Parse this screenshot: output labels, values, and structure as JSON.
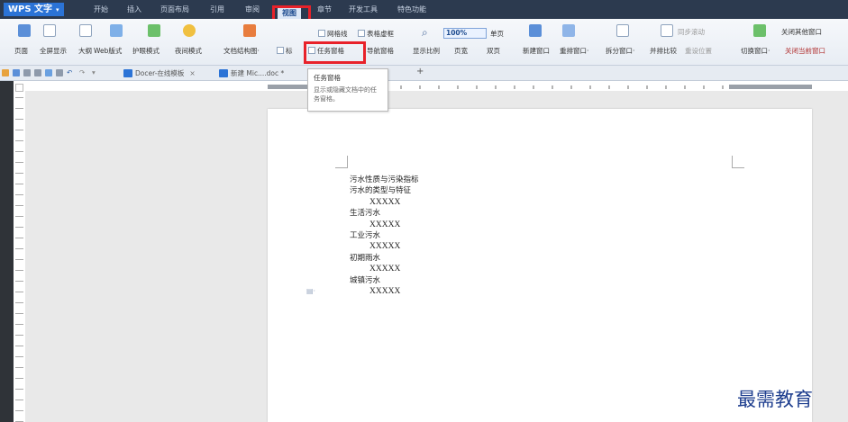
{
  "app": {
    "name": "WPS 文字"
  },
  "menu": {
    "tabs": [
      "开始",
      "插入",
      "页面布局",
      "引用",
      "审阅",
      "视图",
      "章节",
      "开发工具",
      "特色功能"
    ],
    "active": "视图"
  },
  "ribbon": {
    "left_buttons": [
      "页面",
      "全屏显示",
      "大纲",
      "Web版式",
      "护眼模式",
      "夜间模式"
    ],
    "doc_structure": "文档结构图·",
    "checkbox_fragment": "标",
    "gridlines": "网格线",
    "table_grid": "表格虚框",
    "task_pane": "任务窗格",
    "nav_pane": "导航窗格",
    "zoom_label": "显示比例",
    "zoom_value": "100%",
    "single_page": "单页",
    "page_width": "页宽",
    "two_pages": "双页",
    "new_window": "新建窗口",
    "arrange_window": "重排窗口·",
    "split_window": "拆分窗口·",
    "side_by_side": "并排比较",
    "sync_scroll": "同步滚动",
    "reset_position": "重设位置",
    "switch_window": "切换窗口·",
    "close_other": "关闭其他窗口",
    "close_current": "关闭当前窗口"
  },
  "tabbar": {
    "tabs": [
      "Docer-在线模板",
      "新建 Mic....doc *"
    ],
    "add": "+"
  },
  "tooltip": {
    "title": "任务窗格",
    "description": "显示或隐藏文档中的任务窗格。"
  },
  "document": {
    "lines": [
      {
        "text": "污水性质与污染指标",
        "kind": "heading"
      },
      {
        "text": "污水的类型与特征",
        "kind": "heading"
      },
      {
        "text": "XXXXX",
        "kind": "body"
      },
      {
        "text": "生活污水",
        "kind": "heading"
      },
      {
        "text": "XXXXX",
        "kind": "body"
      },
      {
        "text": "工业污水",
        "kind": "heading"
      },
      {
        "text": "XXXXX",
        "kind": "body"
      },
      {
        "text": "初期雨水",
        "kind": "heading"
      },
      {
        "text": "XXXXX",
        "kind": "body"
      },
      {
        "text": "城镇污水",
        "kind": "heading"
      },
      {
        "text": "XXXXX",
        "kind": "body"
      }
    ]
  },
  "watermark": "最需教育",
  "colors": {
    "titlebar": "#2c3a4f",
    "highlight": "#e8222a",
    "logo": "#2b73d6",
    "watermark": "#1f3f8f"
  }
}
